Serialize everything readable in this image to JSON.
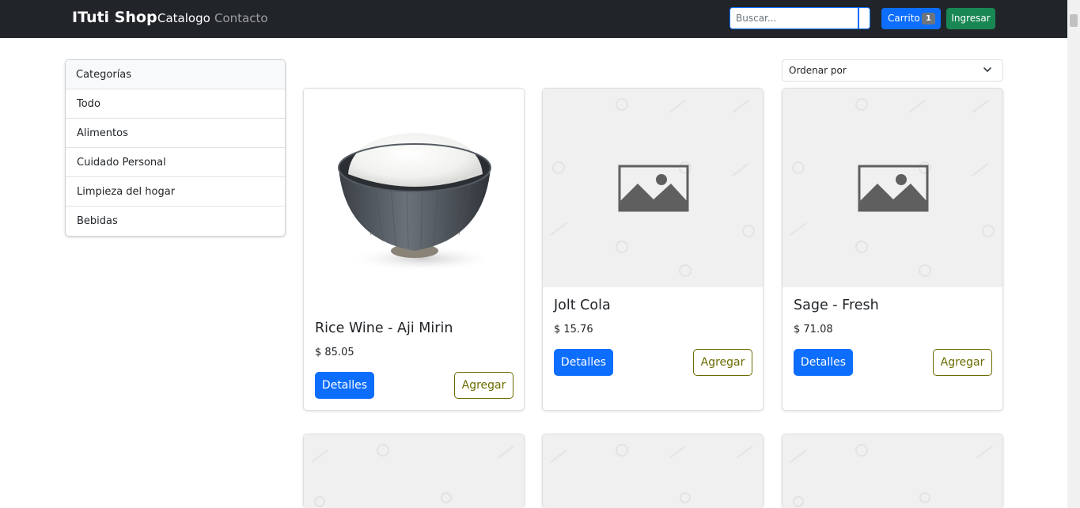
{
  "navbar": {
    "brand": "ITuti Shop",
    "links": [
      {
        "label": "Catalogo",
        "active": true
      },
      {
        "label": "Contacto",
        "active": false
      }
    ],
    "search_placeholder": "Buscar...",
    "cart_label": "Carrito",
    "cart_count": "1",
    "login_label": "Ingresar"
  },
  "sidebar": {
    "header": "Categorías",
    "items": [
      "Todo",
      "Alimentos",
      "Cuidado Personal",
      "Limpieza del hogar",
      "Bebidas"
    ]
  },
  "sort": {
    "selected": "Ordenar por"
  },
  "products": [
    {
      "name": "Rice Wine - Aji Mirin",
      "price": "$ 85.05",
      "image": "rice-bowl-image",
      "details_label": "Detalles",
      "add_label": "Agregar"
    },
    {
      "name": "Jolt Cola",
      "price": "$ 15.76",
      "image": "placeholder-image-icon",
      "details_label": "Detalles",
      "add_label": "Agregar"
    },
    {
      "name": "Sage - Fresh",
      "price": "$ 71.08",
      "image": "placeholder-image-icon",
      "details_label": "Detalles",
      "add_label": "Agregar"
    }
  ],
  "colors": {
    "navbar_bg": "#212529",
    "primary": "#0d6efd",
    "success": "#198754",
    "outline_add": "#6b6b00",
    "placeholder_bg": "#f0f0f0"
  }
}
